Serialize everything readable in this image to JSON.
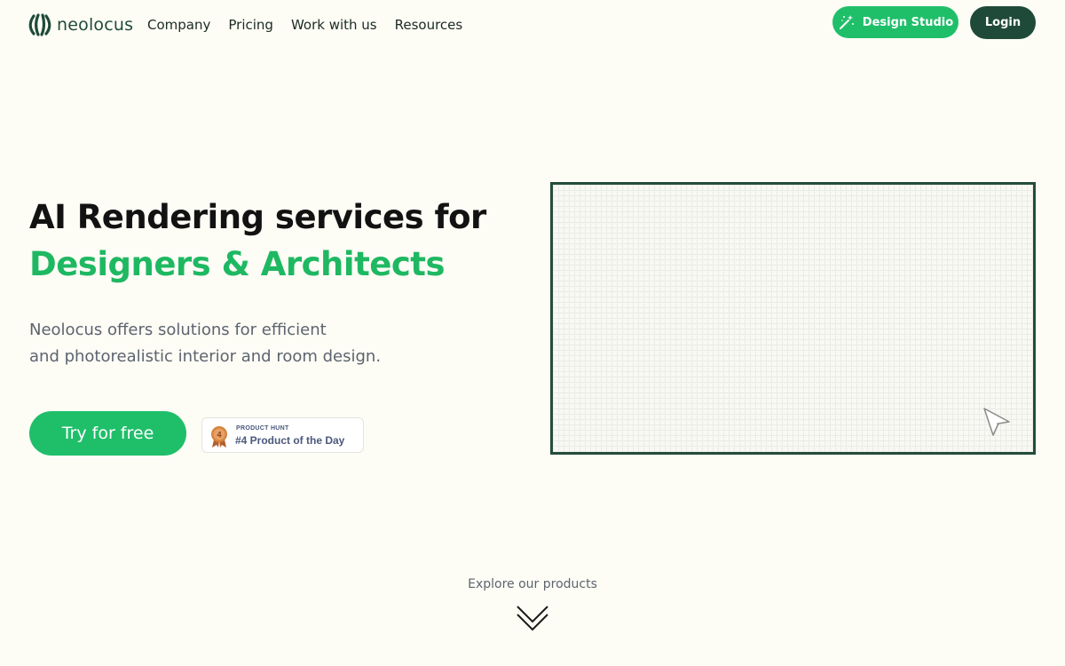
{
  "header": {
    "logo_text": "neolocus",
    "nav": [
      {
        "label": "Company"
      },
      {
        "label": "Pricing"
      },
      {
        "label": "Work with us"
      },
      {
        "label": "Resources"
      }
    ],
    "studio_button": {
      "label": "Design Studio",
      "icon": "magic-wand-icon"
    },
    "login_button": {
      "label": "Login"
    }
  },
  "hero": {
    "title_line1": "AI Rendering services for",
    "title_line2": "Designers & Architects",
    "desc_line1": "Neolocus offers solutions for efficient",
    "desc_line2": "and photorealistic interior and room design.",
    "cta_label": "Try for free",
    "badge": {
      "kicker": "PRODUCT HUNT",
      "rank": "4",
      "text": "#4 Product of the Day"
    }
  },
  "explore": {
    "label": "Explore our products"
  },
  "colors": {
    "background": "#fdfcf5",
    "accent_green": "#1fbf6a",
    "dark_green": "#1f4a3a",
    "text_muted": "#5d6470"
  }
}
